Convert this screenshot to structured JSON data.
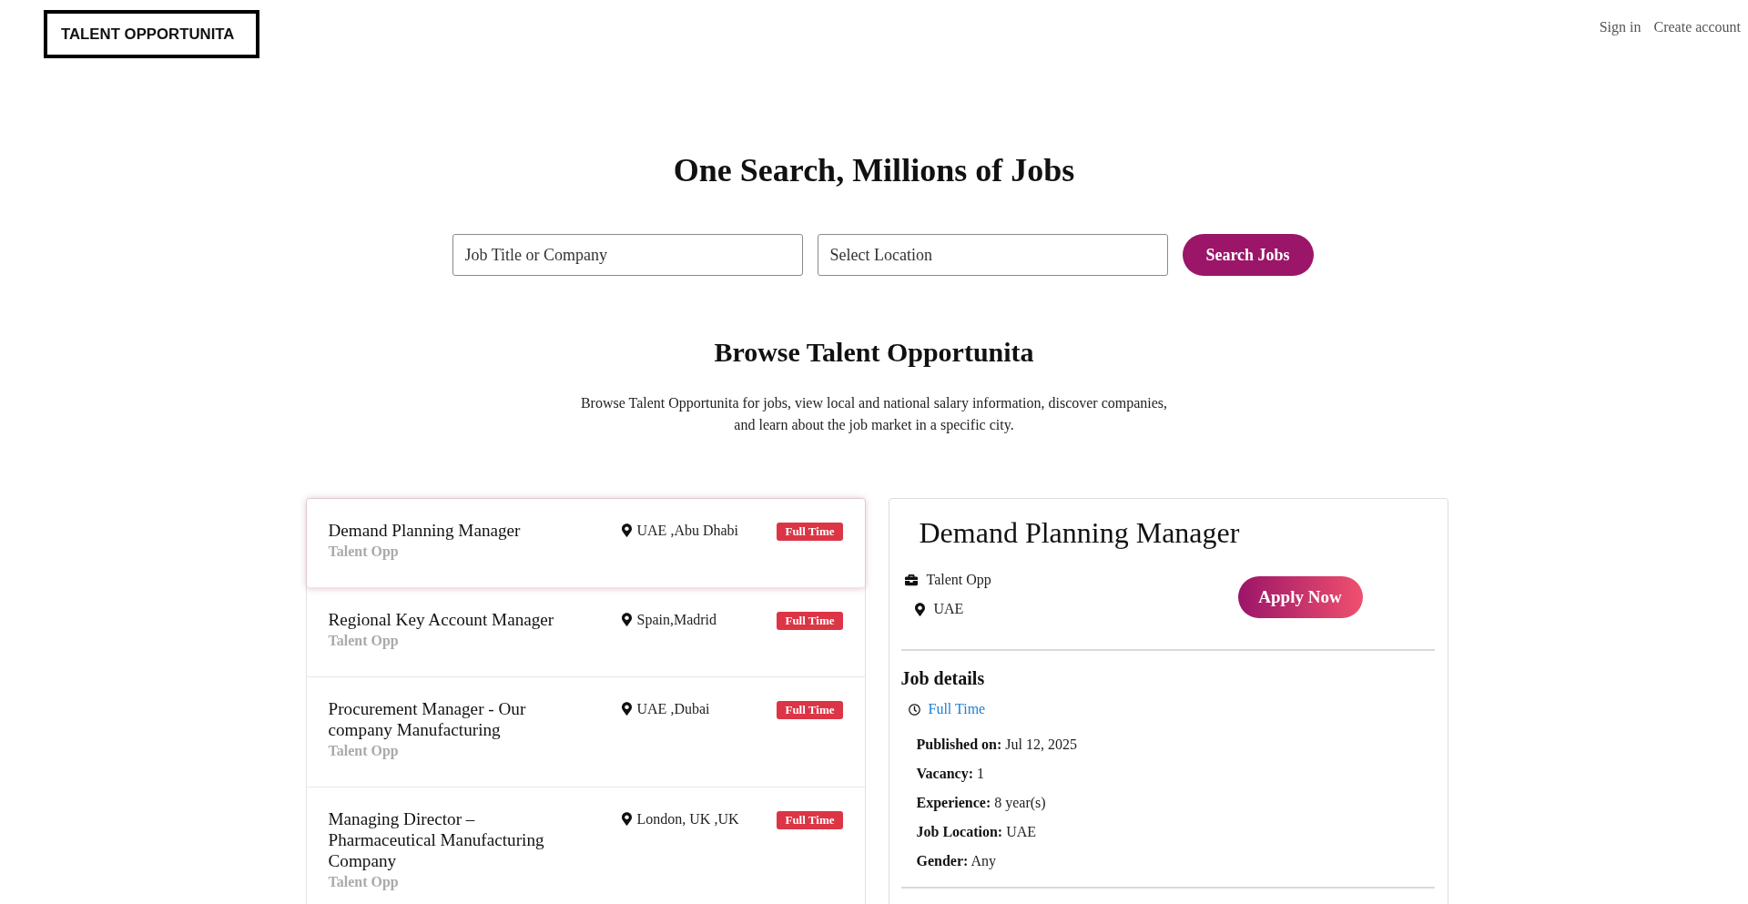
{
  "header": {
    "logo": "TALENT OPPORTUNITA",
    "links": [
      "Sign in",
      "Create account"
    ]
  },
  "hero": {
    "title": "One Search, Millions of Jobs",
    "fields": [
      {
        "placeholder": "Job Title or Company"
      },
      {
        "placeholder": "Select Location"
      }
    ],
    "button": "Search Jobs"
  },
  "browse": {
    "title": "Browse Talent Opportunita",
    "description": "Browse Talent Opportunita for jobs, view local and national salary information, discover companies, and learn about the job market in a specific city."
  },
  "job_list": [
    {
      "title": "Demand Planning Manager",
      "company": "Talent Opp",
      "location": "UAE ,Abu Dhabi",
      "type": "Full Time",
      "selected": true
    },
    {
      "title": "Regional Key Account Manager",
      "company": "Talent Opp",
      "location": "Spain,Madrid",
      "type": "Full Time",
      "selected": false
    },
    {
      "title": "Procurement Manager - Our company Manufacturing",
      "company": "Talent Opp",
      "location": "UAE ,Dubai",
      "type": "Full Time",
      "selected": false
    },
    {
      "title": "Managing Director – Pharmaceutical Manufacturing Company",
      "company": "Talent Opp",
      "location": "London, UK ,UK",
      "type": "Full Time",
      "selected": false
    }
  ],
  "job_detail": {
    "title": "Demand Planning Manager",
    "company": "Talent Opp",
    "location": "UAE",
    "apply_button": "Apply Now",
    "details_heading": "Job details",
    "job_type": "Full Time",
    "facts": [
      {
        "label": "Published on:",
        "value": "Jul 12, 2025"
      },
      {
        "label": "Vacancy:",
        "value": "1"
      },
      {
        "label": "Experience:",
        "value": "8 year(s)"
      },
      {
        "label": "Job Location:",
        "value": "UAE"
      },
      {
        "label": "Gender:",
        "value": "Any"
      }
    ]
  }
}
